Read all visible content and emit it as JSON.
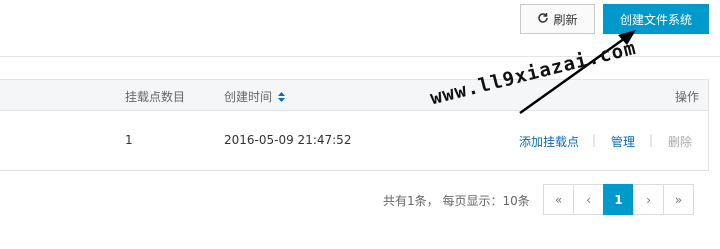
{
  "toolbar": {
    "refresh_label": "刷新",
    "create_label": "创建文件系统"
  },
  "table": {
    "headers": {
      "mount_count": "挂载点数目",
      "created_time": "创建时间",
      "actions": "操作"
    },
    "rows": [
      {
        "mount_count": "1",
        "created_time": "2016-05-09 21:47:52",
        "action_add": "添加挂载点",
        "action_manage": "管理",
        "action_delete": "删除"
      }
    ]
  },
  "pagination": {
    "info": "共有1条， 每页显示：10条",
    "first": "«",
    "prev": "‹",
    "current": "1",
    "next": "›",
    "last": "»"
  },
  "watermark": "www.ll9xiazai.com",
  "colors": {
    "primary": "#0099cc",
    "link": "#0a6eb8",
    "disabled": "#aaaaaa"
  }
}
